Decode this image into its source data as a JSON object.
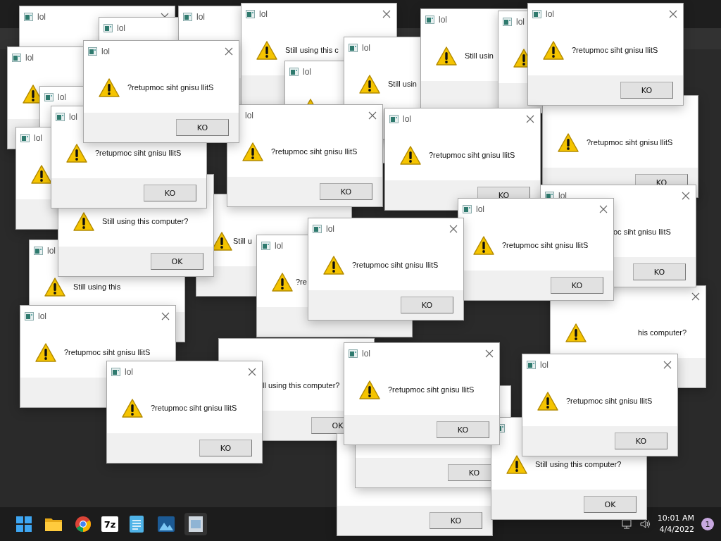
{
  "windows": [
    {
      "title": "lol"
    },
    {
      "title": "lol"
    },
    {
      "title": "lol"
    },
    {
      "title": "lol",
      "message": "Still using this c"
    },
    {
      "title": "lol",
      "message": "Still usin"
    },
    {
      "title": "lol"
    },
    {
      "title": "lol",
      "message": "?retupmoc siht gnisu llitS",
      "button": "KO"
    },
    {
      "title": "lol"
    },
    {
      "title": "lol",
      "message": "?retupmoc siht gnisu llitS",
      "button": "KO"
    },
    {
      "title": "lol"
    },
    {
      "title": "lol",
      "message": "Still usin"
    },
    {
      "title": "lol"
    },
    {
      "title": "lol",
      "message": "?retupmoc siht gnisu llitS",
      "button": "KO"
    },
    {
      "title": "lol",
      "message": "?retupmoc siht gnisu llitS",
      "button": "KO"
    },
    {
      "title": "lol",
      "message": "?retupmoc siht gnisu llitS",
      "button": "KO"
    },
    {
      "message": "?retupmoc siht gnisu llitS",
      "button": "KO"
    },
    {
      "title": "lol"
    },
    {
      "message": "Still using this computer?",
      "button": "OK"
    },
    {
      "message": "Still u"
    },
    {
      "title": "lol",
      "message": "?retupmoc siht gnisu llitS",
      "button": "KO"
    },
    {
      "title": "lol",
      "message": "oc siht gnisu llitS",
      "button": "KO"
    },
    {
      "title": "lol",
      "message": "Still using this"
    },
    {
      "title": "lol",
      "message": "?re"
    },
    {
      "title": "lol",
      "message": "?retupmoc siht gnisu llitS",
      "button": "KO"
    },
    {
      "title": "lol",
      "message": "?retupmoc siht gnisu llitS"
    },
    {
      "message": "his computer?"
    },
    {
      "title": "lol",
      "message": "?retupmoc siht gnisu llitS",
      "button": "KO"
    },
    {
      "message": "ll using this computer?",
      "button": "OK"
    },
    {
      "title": "lol",
      "message": "?retupmoc siht gnisu llitS",
      "button": "KO"
    },
    {
      "title": "lol",
      "message": "?retupmoc siht gnisu llitS",
      "button": "KO"
    },
    {
      "button": "KO"
    },
    {
      "button": "KO"
    },
    {
      "message": "Still using this computer?",
      "button": "OK"
    }
  ],
  "taskbar": {
    "apps": [
      {
        "kind": "start"
      },
      {
        "kind": "folder"
      },
      {
        "kind": "browser"
      },
      {
        "kind": "archiver",
        "label": "7z"
      },
      {
        "kind": "notepad"
      },
      {
        "kind": "photos"
      },
      {
        "kind": "app"
      }
    ],
    "time": "10:01 AM",
    "date": "4/4/2022",
    "notifications": "1"
  }
}
